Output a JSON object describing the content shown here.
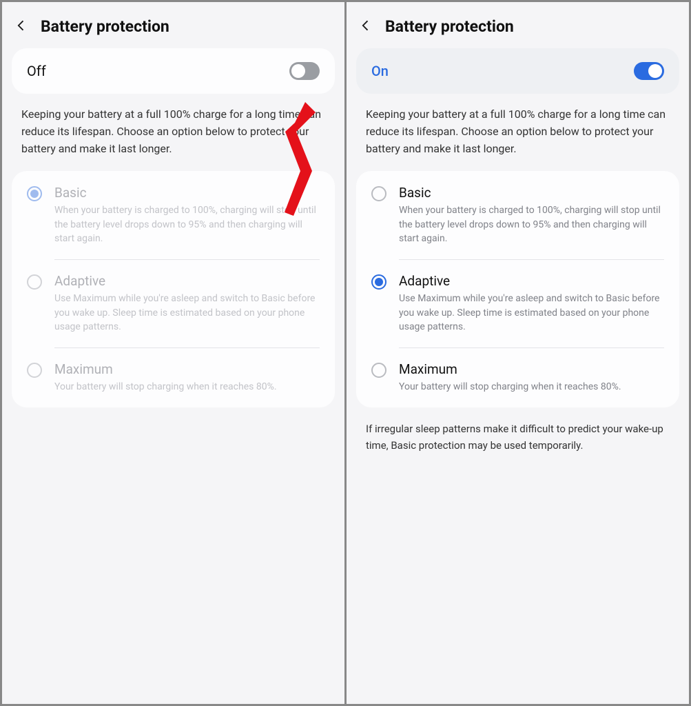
{
  "panes": [
    {
      "title": "Battery protection",
      "toggle": {
        "label": "Off",
        "on": false
      },
      "description": "Keeping your battery at a full 100% charge for a long time can reduce its lifespan. Choose an option below to protect your battery and make it last longer.",
      "options_disabled": true,
      "options": [
        {
          "title": "Basic",
          "desc": "When your battery is charged to 100%, charging will stop until the battery level drops down to 95% and then charging will start again.",
          "selected": true
        },
        {
          "title": "Adaptive",
          "desc": "Use Maximum while you're asleep and switch to Basic before you wake up. Sleep time is estimated based on your phone usage patterns.",
          "selected": false
        },
        {
          "title": "Maximum",
          "desc": "Your battery will stop charging when it reaches 80%.",
          "selected": false
        }
      ],
      "footnote": "",
      "arrow": true
    },
    {
      "title": "Battery protection",
      "toggle": {
        "label": "On",
        "on": true
      },
      "description": "Keeping your battery at a full 100% charge for a long time can reduce its lifespan. Choose an option below to protect your battery and make it last longer.",
      "options_disabled": false,
      "options": [
        {
          "title": "Basic",
          "desc": "When your battery is charged to 100%, charging will stop until the battery level drops down to 95% and then charging will start again.",
          "selected": false
        },
        {
          "title": "Adaptive",
          "desc": "Use Maximum while you're asleep and switch to Basic before you wake up. Sleep time is estimated based on your phone usage patterns.",
          "selected": true
        },
        {
          "title": "Maximum",
          "desc": "Your battery will stop charging when it reaches 80%.",
          "selected": false
        }
      ],
      "footnote": "If irregular sleep patterns make it difficult to predict your wake-up time, Basic protection may be used temporarily.",
      "arrow": false
    }
  ]
}
